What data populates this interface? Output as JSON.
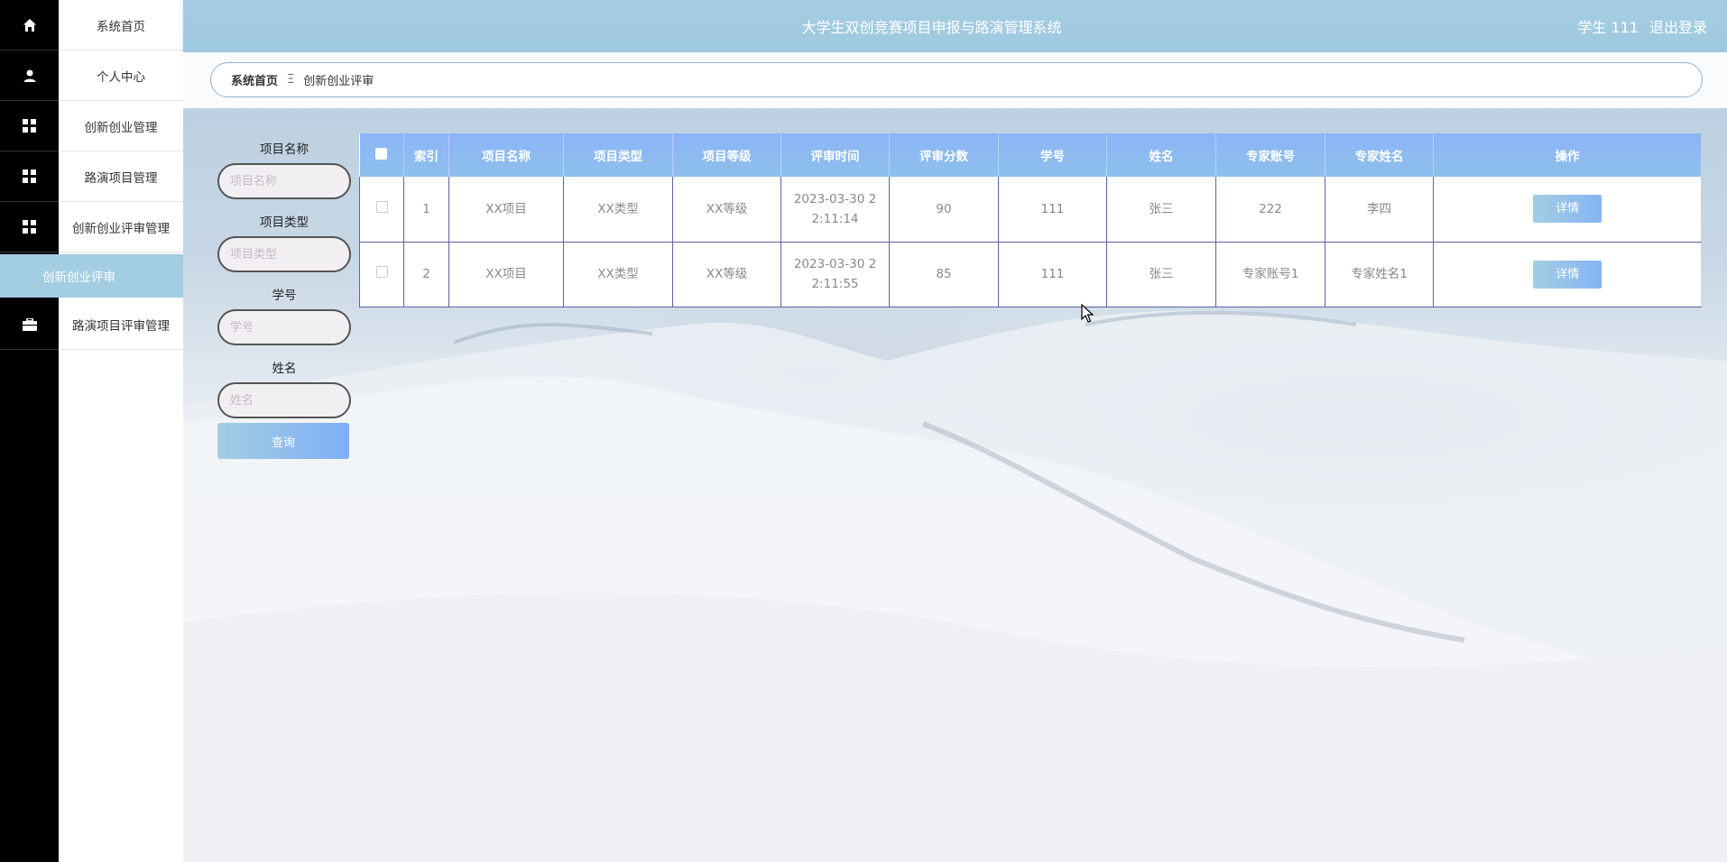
{
  "header": {
    "title": "大学生双创竞赛项目申报与路演管理系统",
    "user": "学生 111",
    "logout": "退出登录"
  },
  "sidebar": {
    "items": [
      {
        "label": "系统首页",
        "icon": "home-icon"
      },
      {
        "label": "个人中心",
        "icon": "user-icon"
      },
      {
        "label": "创新创业管理",
        "icon": "grid-icon"
      },
      {
        "label": "路演项目管理",
        "icon": "grid-icon"
      },
      {
        "label": "创新创业评审管理",
        "icon": "grid-icon"
      },
      {
        "label": "路演项目评审管理",
        "icon": "briefcase-icon"
      }
    ],
    "active_sub": "创新创业评审"
  },
  "breadcrumb": {
    "home": "系统首页",
    "separator": "Ξ",
    "current": "创新创业评审"
  },
  "search": {
    "fields": [
      {
        "label": "项目名称",
        "placeholder": "项目名称"
      },
      {
        "label": "项目类型",
        "placeholder": "项目类型"
      },
      {
        "label": "学号",
        "placeholder": "学号"
      },
      {
        "label": "姓名",
        "placeholder": "姓名"
      }
    ],
    "button": "查询"
  },
  "table": {
    "columns": [
      "索引",
      "项目名称",
      "项目类型",
      "项目等级",
      "评审时间",
      "评审分数",
      "学号",
      "姓名",
      "专家账号",
      "专家姓名",
      "操作"
    ],
    "rows": [
      {
        "index": "1",
        "name": "XX项目",
        "type": "XX类型",
        "level": "XX等级",
        "time_a": "2023-03-30 2",
        "time_b": "2:11:14",
        "score": "90",
        "student_no": "111",
        "student_name": "张三",
        "expert_account": "222",
        "expert_name": "李四",
        "action": "详情"
      },
      {
        "index": "2",
        "name": "XX项目",
        "type": "XX类型",
        "level": "XX等级",
        "time_a": "2023-03-30 2",
        "time_b": "2:11:55",
        "score": "85",
        "student_no": "111",
        "student_name": "张三",
        "expert_account": "专家账号1",
        "expert_name": "专家姓名1",
        "action": "详情"
      }
    ]
  },
  "colors": {
    "header_bg": "#a4cde3",
    "sidebar_bg": "#000000",
    "table_head": "#8bb4f7",
    "active_nav": "#a3cde2"
  }
}
